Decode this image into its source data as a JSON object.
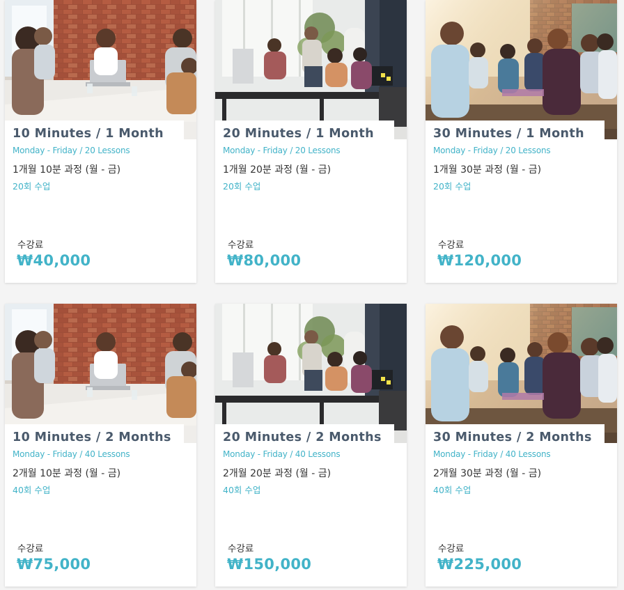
{
  "colors": {
    "accent": "#42b3c8",
    "title": "#4a5a6c",
    "text": "#333333",
    "card_bg": "#ffffff",
    "page_bg": "#f4f4f4"
  },
  "cards": [
    {
      "image": "office-meeting-photo",
      "title": "10 Minutes / 1 Month",
      "subtitle": "Monday - Friday / 20 Lessons",
      "course": "1개월 10분 과정 (월 - 금)",
      "lessons": "20회 수업",
      "fee_label": "수강료",
      "price": "₩40,000"
    },
    {
      "image": "team-office-photo",
      "title": "20 Minutes / 1 Month",
      "subtitle": "Monday - Friday / 20 Lessons",
      "course": "1개월 20분 과정 (월 - 금)",
      "lessons": "20회 수업",
      "fee_label": "수강료",
      "price": "₩80,000"
    },
    {
      "image": "group-discussion-photo",
      "title": "30 Minutes / 1 Month",
      "subtitle": "Monday - Friday / 20 Lessons",
      "course": "1개월 30분 과정 (월 - 금)",
      "lessons": "20회 수업",
      "fee_label": "수강료",
      "price": "₩120,000"
    },
    {
      "image": "office-meeting-photo",
      "title": "10 Minutes / 2 Months",
      "subtitle": "Monday - Friday / 40 Lessons",
      "course": "2개월 10분 과정 (월 - 금)",
      "lessons": "40회 수업",
      "fee_label": "수강료",
      "price": "₩75,000"
    },
    {
      "image": "team-office-photo",
      "title": "20 Minutes / 2 Months",
      "subtitle": "Monday - Friday / 40 Lessons",
      "course": "2개월 20분 과정 (월 - 금)",
      "lessons": "40회 수업",
      "fee_label": "수강료",
      "price": "₩150,000"
    },
    {
      "image": "group-discussion-photo",
      "title": "30 Minutes / 2 Months",
      "subtitle": "Monday - Friday / 40 Lessons",
      "course": "2개월 30분 과정 (월 - 금)",
      "lessons": "40회 수업",
      "fee_label": "수강료",
      "price": "₩225,000"
    }
  ]
}
